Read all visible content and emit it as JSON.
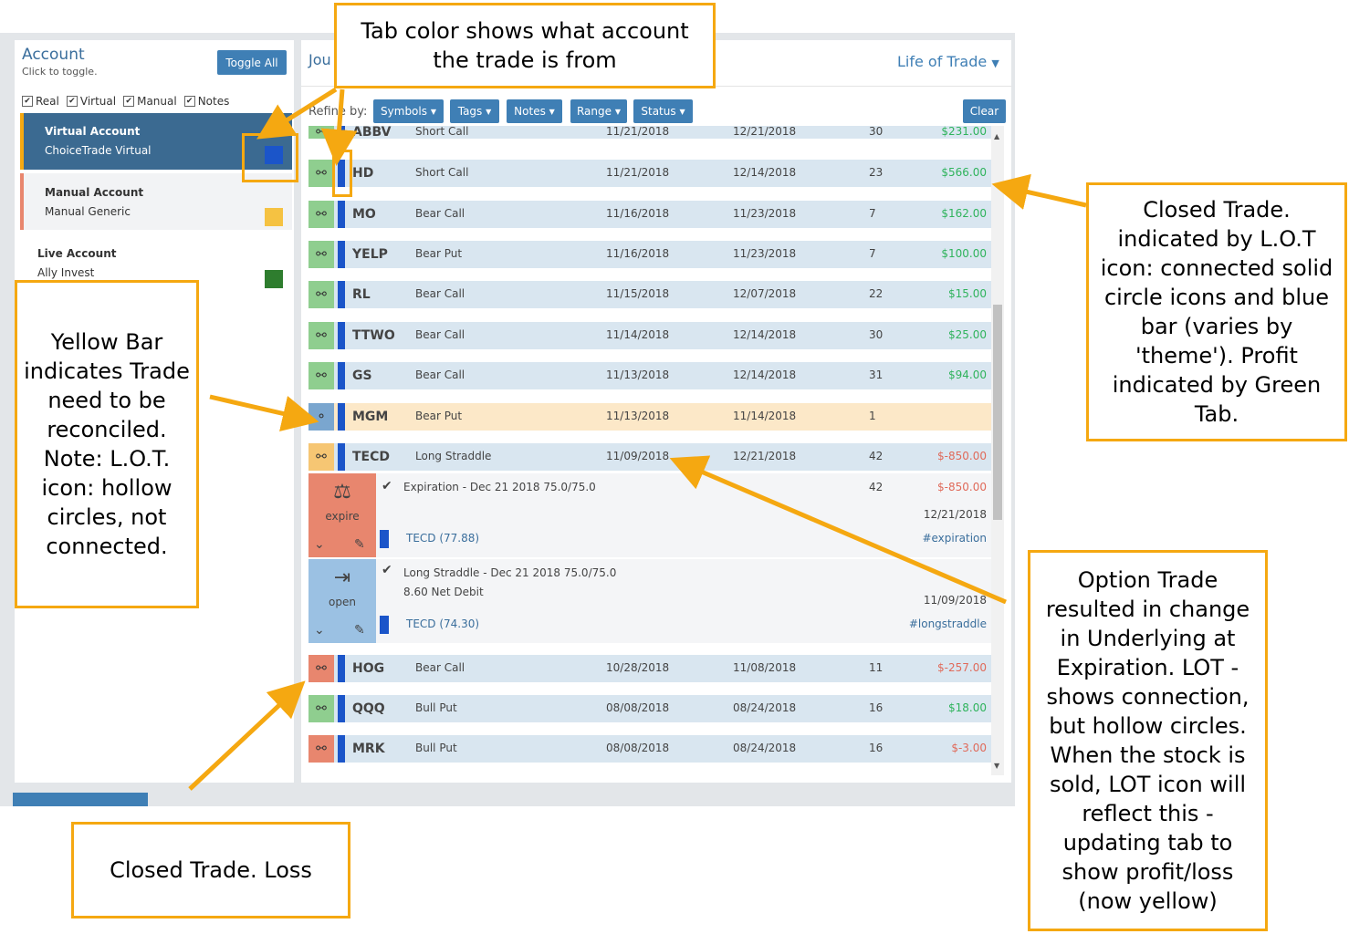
{
  "account": {
    "title": "Account",
    "subtitle": "Click to toggle.",
    "toggle_all": "Toggle All",
    "filters": [
      "Real",
      "Virtual",
      "Manual",
      "Notes"
    ],
    "cards": [
      {
        "name": "Virtual Account",
        "sub": "ChoiceTrade Virtual",
        "color": "#1b55c9"
      },
      {
        "name": "Manual Account",
        "sub": "Manual Generic",
        "color": "#f5c242"
      },
      {
        "name": "Live Account",
        "sub": "Ally Invest",
        "color": "#2e7d2e"
      }
    ]
  },
  "journal": {
    "title_partial": "Jou",
    "view": "Life of Trade",
    "refine_label": "Refine by:",
    "filters": [
      "Symbols",
      "Tags",
      "Notes",
      "Range",
      "Status"
    ],
    "clear": "Clear",
    "rows": [
      {
        "symbol": "ABBV",
        "strategy": "Short Call",
        "open": "11/21/2018",
        "close": "12/21/2018",
        "days": "30",
        "pl": "$231.00"
      },
      {
        "symbol": "HD",
        "strategy": "Short Call",
        "open": "11/21/2018",
        "close": "12/14/2018",
        "days": "23",
        "pl": "$566.00"
      },
      {
        "symbol": "MO",
        "strategy": "Bear Call",
        "open": "11/16/2018",
        "close": "11/23/2018",
        "days": "7",
        "pl": "$162.00"
      },
      {
        "symbol": "YELP",
        "strategy": "Bear Put",
        "open": "11/16/2018",
        "close": "11/23/2018",
        "days": "7",
        "pl": "$100.00"
      },
      {
        "symbol": "RL",
        "strategy": "Bear Call",
        "open": "11/15/2018",
        "close": "12/07/2018",
        "days": "22",
        "pl": "$15.00"
      },
      {
        "symbol": "TTWO",
        "strategy": "Bear Call",
        "open": "11/14/2018",
        "close": "12/14/2018",
        "days": "30",
        "pl": "$25.00"
      },
      {
        "symbol": "GS",
        "strategy": "Bear Call",
        "open": "11/13/2018",
        "close": "12/14/2018",
        "days": "31",
        "pl": "$94.00"
      },
      {
        "symbol": "MGM",
        "strategy": "Bear Put",
        "open": "11/13/2018",
        "close": "11/14/2018",
        "days": "1",
        "pl": ""
      },
      {
        "symbol": "TECD",
        "strategy": "Long Straddle",
        "open": "11/09/2018",
        "close": "12/21/2018",
        "days": "42",
        "pl": "$-850.00"
      },
      {
        "symbol": "HOG",
        "strategy": "Bear Call",
        "open": "10/28/2018",
        "close": "11/08/2018",
        "days": "11",
        "pl": "$-257.00"
      },
      {
        "symbol": "QQQ",
        "strategy": "Bull Put",
        "open": "08/08/2018",
        "close": "08/24/2018",
        "days": "16",
        "pl": "$18.00"
      },
      {
        "symbol": "MRK",
        "strategy": "Bull Put",
        "open": "08/08/2018",
        "close": "08/24/2018",
        "days": "16",
        "pl": "$-3.00"
      }
    ],
    "expire": {
      "label": "expire",
      "desc": "Expiration - Dec 21 2018 75.0/75.0",
      "days": "42",
      "pl": "$-850.00",
      "date": "12/21/2018",
      "underlying": "TECD (77.88)",
      "tag": "#expiration"
    },
    "open": {
      "label": "open",
      "desc": "Long Straddle - Dec 21 2018 75.0/75.0",
      "desc2": "8.60 Net Debit",
      "date": "11/09/2018",
      "underlying": "TECD (74.30)",
      "tag": "#longstraddle"
    }
  },
  "callouts": {
    "tab_color": "Tab color shows what account the trade is from",
    "closed_trade": "Closed Trade. indicated by L.O.T icon:  connected solid circle icons and blue bar (varies by 'theme'). Profit indicated by Green Tab.",
    "yellow_bar": "Yellow Bar indicates Trade need to be reconciled. Note: L.O.T. icon: hollow circles, not connected.",
    "option_trade": "Option Trade resulted in change in Underlying at Expiration.  LOT - shows connection, but hollow circles. When the stock is sold, LOT icon will reflect this - updating tab to show profit/loss (now yellow)",
    "closed_loss": "Closed Trade. Loss"
  },
  "colors": {
    "accent": "#3f7fb5",
    "callout_border": "#f5a811",
    "profit_tab": "#8fce8f",
    "loss_tab": "#e8866e",
    "reconcile_tab": "#f6c673",
    "account_bar": "#1b55c9"
  }
}
